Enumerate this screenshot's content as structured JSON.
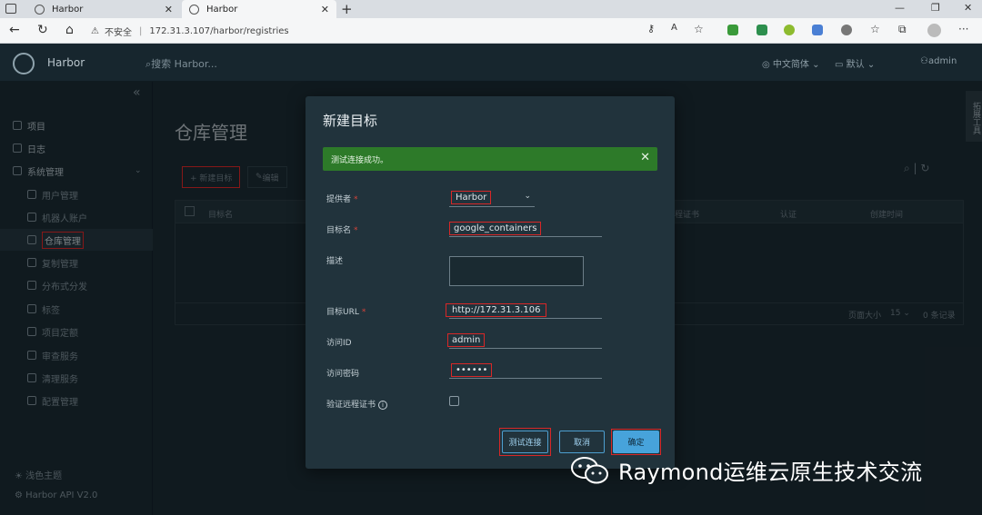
{
  "browser": {
    "tabs": [
      {
        "title": "Harbor",
        "active": false
      },
      {
        "title": "Harbor",
        "active": true
      }
    ],
    "security_label": "不安全",
    "url": "172.31.3.107/harbor/registries"
  },
  "header": {
    "logo_text": "Harbor",
    "search_placeholder": "搜索 Harbor...",
    "language": "中文简体",
    "project": "默认",
    "user": "admin"
  },
  "sidebar": {
    "items": [
      {
        "label": "项目",
        "level": "top"
      },
      {
        "label": "日志",
        "level": "top"
      },
      {
        "label": "系统管理",
        "level": "top"
      },
      {
        "label": "用户管理",
        "level": "sub"
      },
      {
        "label": "机器人账户",
        "level": "sub"
      },
      {
        "label": "仓库管理",
        "level": "sub",
        "active": true
      },
      {
        "label": "复制管理",
        "level": "sub"
      },
      {
        "label": "分布式分发",
        "level": "sub"
      },
      {
        "label": "标签",
        "level": "sub"
      },
      {
        "label": "项目定额",
        "level": "sub"
      },
      {
        "label": "审查服务",
        "level": "sub"
      },
      {
        "label": "清理服务",
        "level": "sub"
      },
      {
        "label": "配置管理",
        "level": "sub"
      }
    ],
    "theme_label": "浅色主题",
    "api_label": "Harbor API V2.0"
  },
  "page": {
    "title": "仓库管理",
    "new_target_button": "+ 新建目标",
    "edit_button": "编辑",
    "columns": [
      "目标名",
      "远程证书",
      "认证",
      "创建时间"
    ],
    "page_size_label": "页面大小",
    "page_size_value": "15",
    "total_label": "0 条记录",
    "side_tab_label": "拓展工具"
  },
  "dialog": {
    "title": "新建目标",
    "alert_text": "测试连接成功。",
    "fields": {
      "provider": {
        "label": "提供者",
        "value": "Harbor"
      },
      "name": {
        "label": "目标名",
        "value": "google_containers"
      },
      "description": {
        "label": "描述",
        "value": ""
      },
      "url": {
        "label": "目标URL",
        "value": "http://172.31.3.106"
      },
      "access_id": {
        "label": "访问ID",
        "value": "admin"
      },
      "access_secret": {
        "label": "访问密码",
        "value": "••••••"
      },
      "verify_cert": {
        "label": "验证远程证书",
        "checked": false
      }
    },
    "buttons": {
      "test": "测试连接",
      "cancel": "取消",
      "ok": "确定"
    }
  },
  "watermark": {
    "text": "Raymond运维云原生技术交流"
  }
}
